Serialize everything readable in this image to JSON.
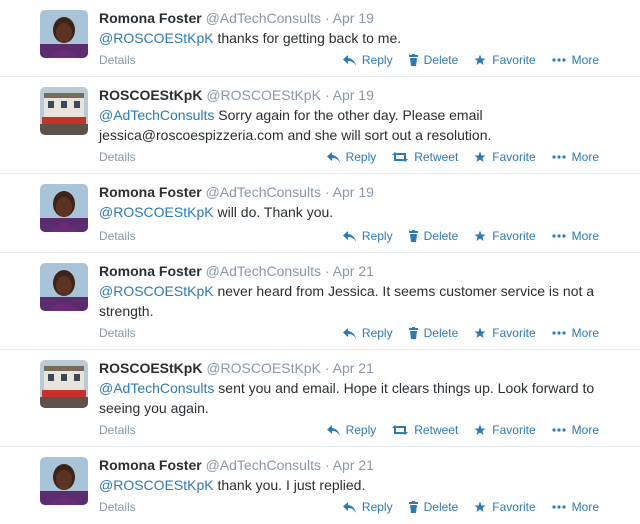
{
  "colors": {
    "link": "#2b7bb9",
    "muted": "#8899a6",
    "text": "#292f33"
  },
  "tweets": [
    {
      "name": "Romona Foster",
      "handle": "@AdTechConsults",
      "dot": "·",
      "time": "Apr 19",
      "mention": "@ROSCOEStKpK",
      "text": " thanks for getting back to me.",
      "details": "Details",
      "reply": "Reply",
      "second": "Delete",
      "favorite": "Favorite",
      "more": "More"
    },
    {
      "name": "ROSCOEStKpK",
      "handle": "@ROSCOEStKpK",
      "dot": "·",
      "time": "Apr 19",
      "mention": "@AdTechConsults",
      "text": "  Sorry again for the other day. Please email jessica@roscoespizzeria.com and she will sort out a resolution.",
      "details": "Details",
      "reply": "Reply",
      "second": "Retweet",
      "favorite": "Favorite",
      "more": "More"
    },
    {
      "name": "Romona Foster",
      "handle": "@AdTechConsults",
      "dot": "·",
      "time": "Apr 19",
      "mention": "@ROSCOEStKpK",
      "text": " will do. Thank you.",
      "details": "Details",
      "reply": "Reply",
      "second": "Delete",
      "favorite": "Favorite",
      "more": "More"
    },
    {
      "name": "Romona Foster",
      "handle": "@AdTechConsults",
      "dot": "·",
      "time": "Apr 21",
      "mention": "@ROSCOEStKpK",
      "text": " never heard from Jessica. It seems customer service is not a strength.",
      "details": "Details",
      "reply": "Reply",
      "second": "Delete",
      "favorite": "Favorite",
      "more": "More"
    },
    {
      "name": "ROSCOEStKpK",
      "handle": "@ROSCOEStKpK",
      "dot": "·",
      "time": "Apr 21",
      "mention": "@AdTechConsults",
      "text": " sent you and email. Hope it clears things up. Look forward to seeing you again.",
      "details": "Details",
      "reply": "Reply",
      "second": "Retweet",
      "favorite": "Favorite",
      "more": "More"
    },
    {
      "name": "Romona Foster",
      "handle": "@AdTechConsults",
      "dot": "·",
      "time": "Apr 21",
      "mention": "@ROSCOEStKpK",
      "text": " thank you. I just replied.",
      "details": "Details",
      "reply": "Reply",
      "second": "Delete",
      "favorite": "Favorite",
      "more": "More"
    }
  ]
}
